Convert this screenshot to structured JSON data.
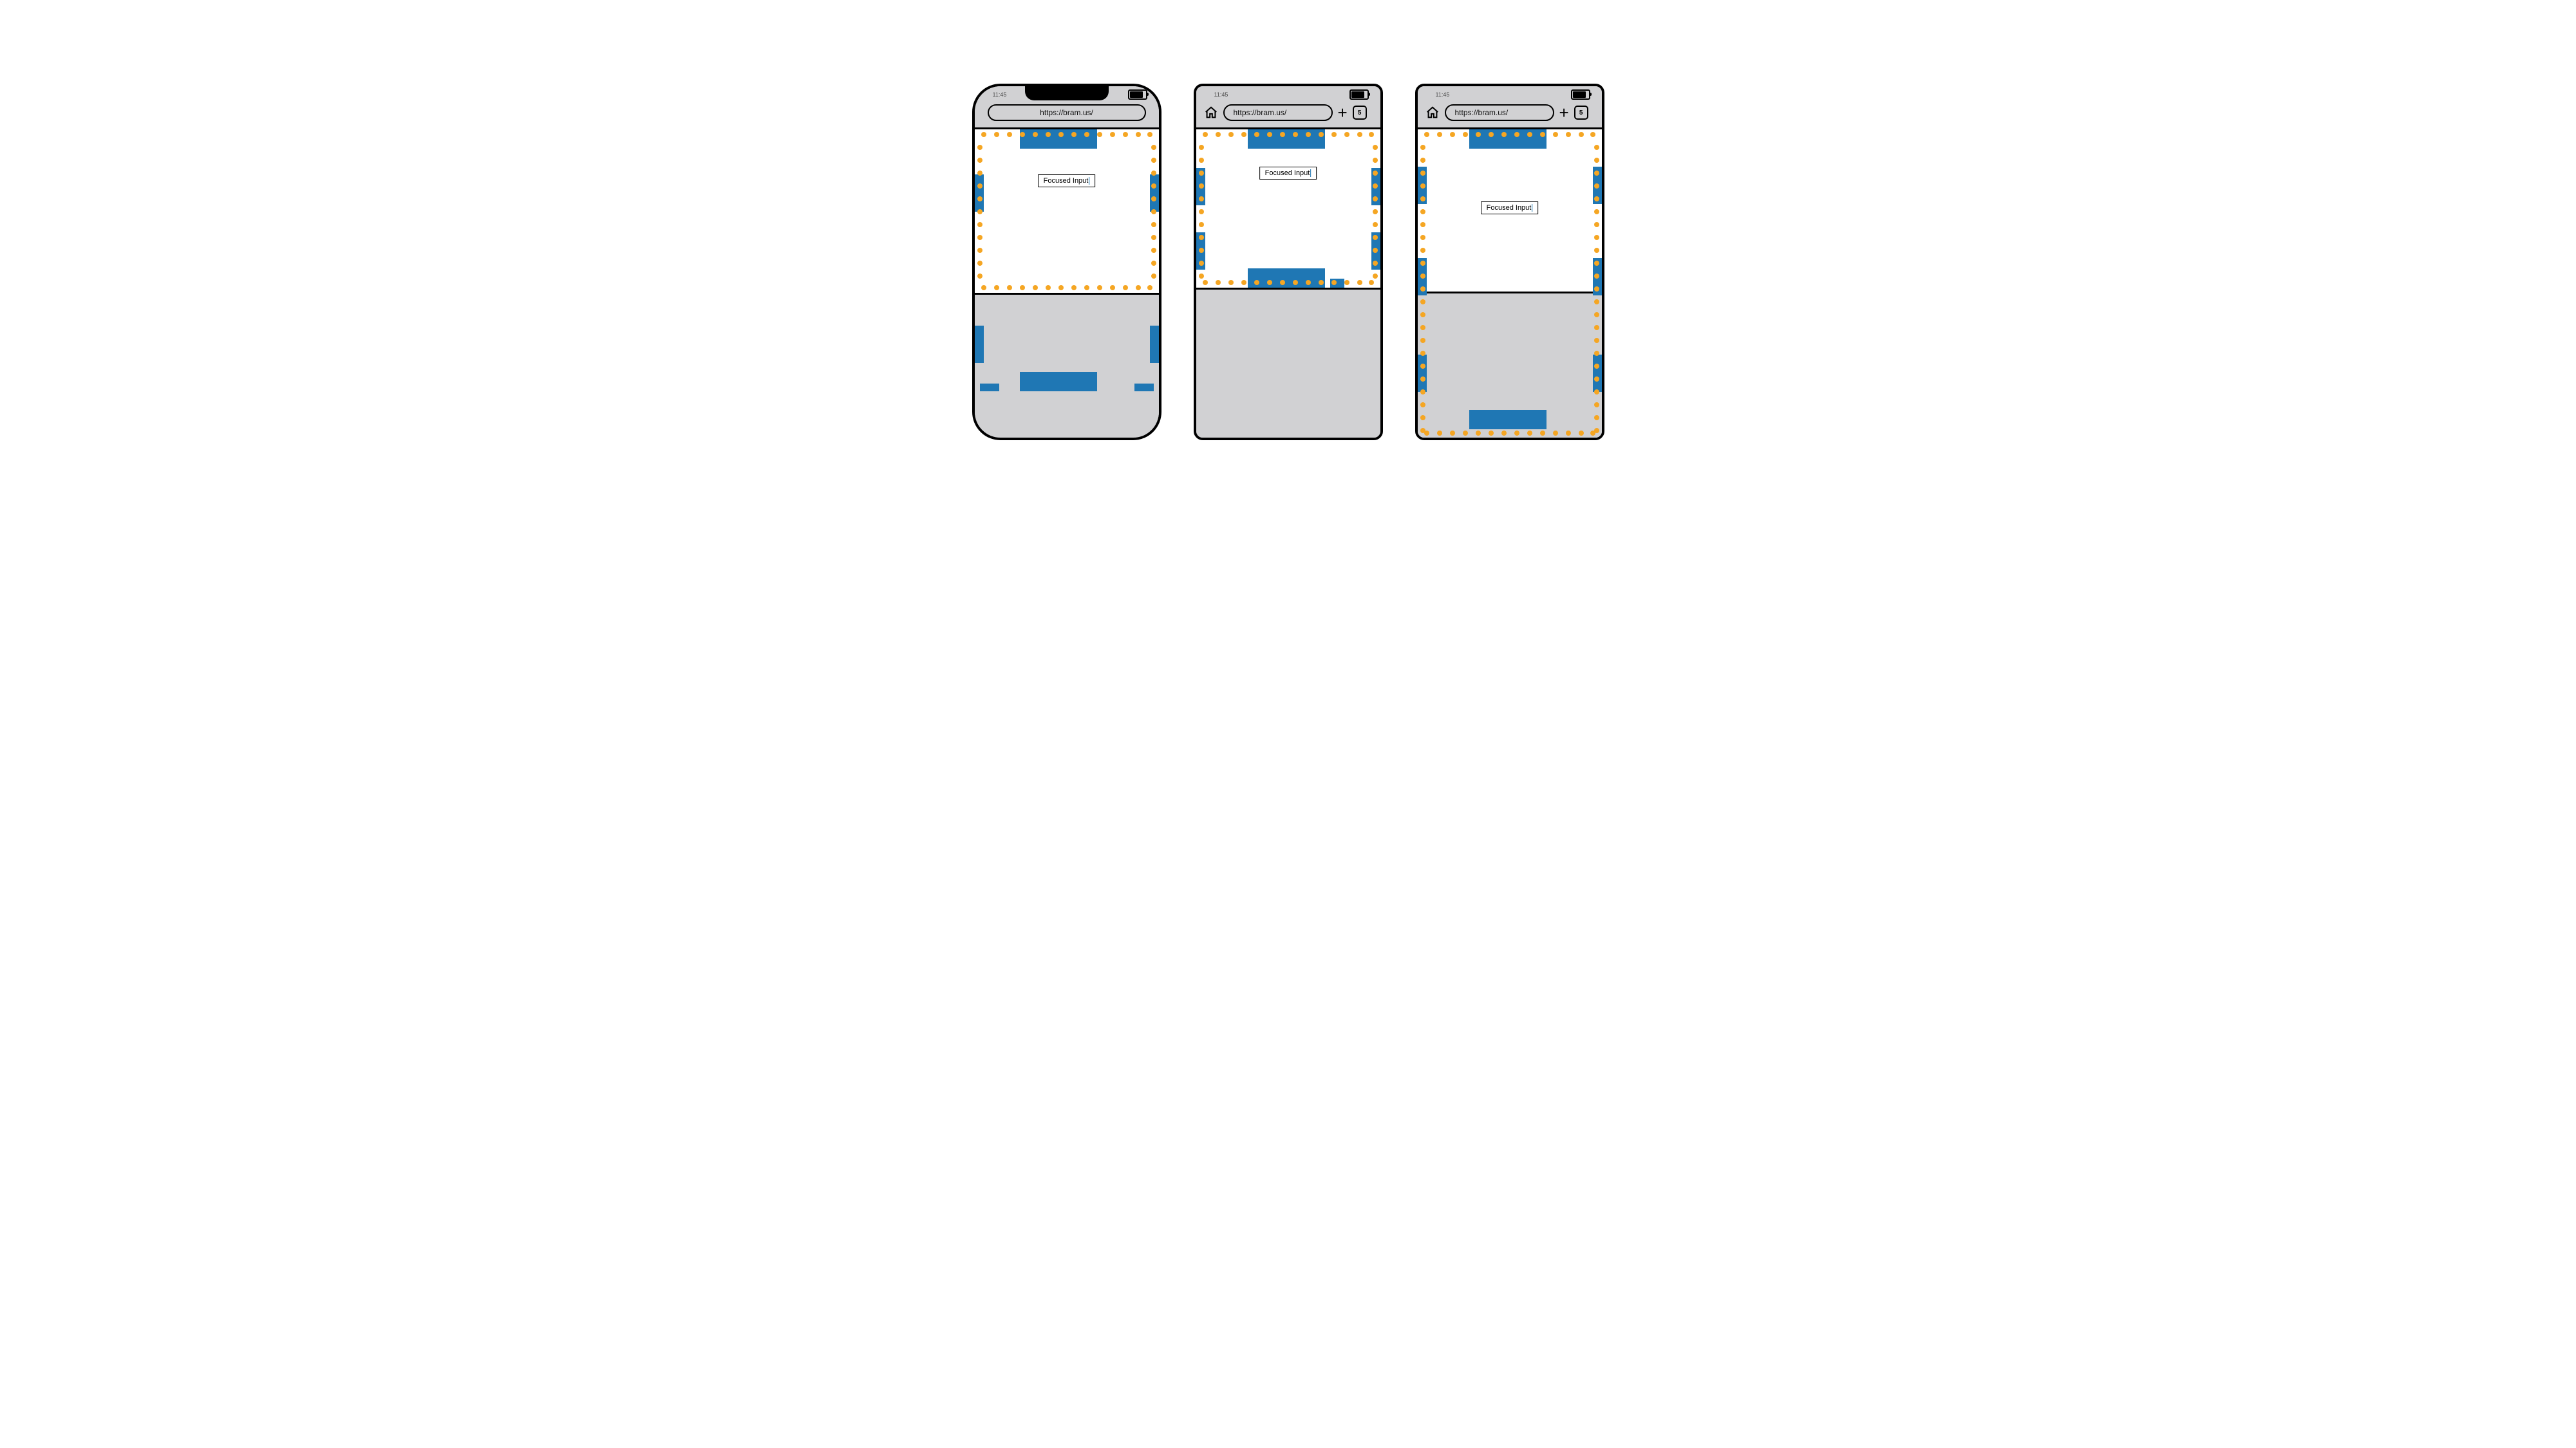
{
  "status": {
    "time": "11:45"
  },
  "url": "https://bram.us/",
  "tab_count": "5",
  "input_label": "Focused Input",
  "colors": {
    "accent": "#1f77b4",
    "dot": "#f5a623",
    "chrome": "#d1d1d3"
  },
  "diagram": {
    "description": "Three mobile browser mockups showing viewport behaviour when the on-screen keyboard is shown and an input is focused.",
    "devices": [
      {
        "id": "ios",
        "notch": true,
        "toolbar": "center",
        "visual_viewport_follows_keyboard": false
      },
      {
        "id": "android-a",
        "notch": false,
        "toolbar": "full",
        "visual_viewport_follows_keyboard": true
      },
      {
        "id": "android-b",
        "notch": false,
        "toolbar": "full",
        "visual_viewport_follows_keyboard": false
      }
    ]
  }
}
